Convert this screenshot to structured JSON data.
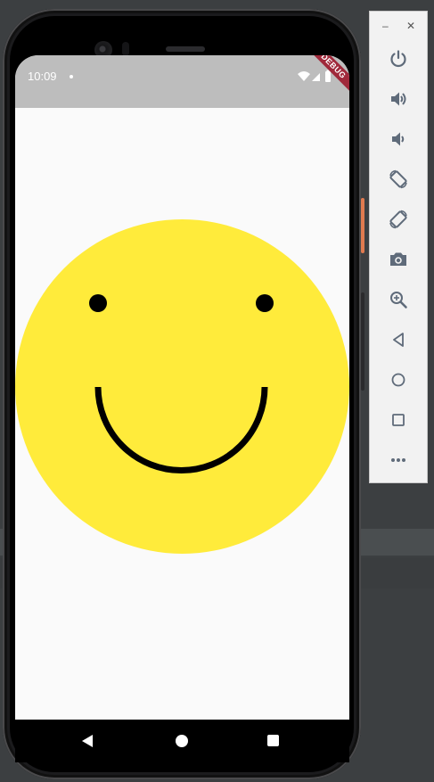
{
  "status_bar": {
    "time": "10:09",
    "debug_banner": "DEBUG"
  },
  "colors": {
    "face": "#ffeb3b",
    "features": "#000000",
    "status_bar": "#bdbdbd",
    "screen_bg": "#fafafa",
    "debug_banner": "#a0293b",
    "toolbar_icon": "#5f6b7a"
  },
  "navigation": {
    "buttons": [
      "back-icon",
      "home-icon",
      "recents-icon"
    ]
  },
  "emulator_toolbar": {
    "window_controls": [
      "minimize-icon",
      "close-icon"
    ],
    "buttons": [
      "power-icon",
      "volume-up-icon",
      "volume-down-icon",
      "rotate-left-icon",
      "rotate-right-icon",
      "camera-icon",
      "zoom-icon",
      "back-icon",
      "home-icon",
      "overview-icon",
      "more-icon"
    ]
  }
}
